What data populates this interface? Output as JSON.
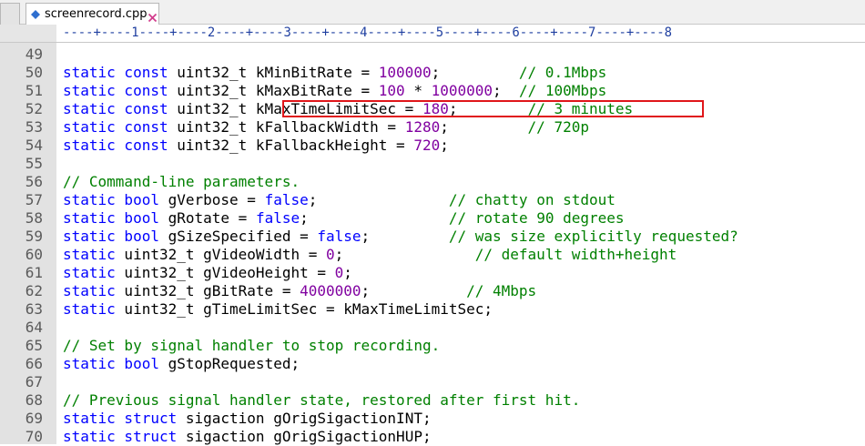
{
  "editor": {
    "tab": {
      "label": "screenrecord.cpp"
    },
    "ruler": "----+----1----+----2----+----3----+----4----+----5----+----6----+----7----+----8"
  },
  "colors": {
    "keyword": "#0000ff",
    "number": "#8000a0",
    "comment": "#008000",
    "highlight_border": "#e0161a"
  },
  "lines": [
    {
      "num": "49",
      "tokens": []
    },
    {
      "num": "50",
      "tokens": [
        {
          "t": "static const",
          "k": "kw"
        },
        {
          "t": " uint32_t kMinBitRate = ",
          "k": "plain"
        },
        {
          "t": "100000",
          "k": "num"
        },
        {
          "t": ";         ",
          "k": "plain"
        },
        {
          "t": "// 0.1Mbps",
          "k": "cm"
        }
      ]
    },
    {
      "num": "51",
      "tokens": [
        {
          "t": "static const",
          "k": "kw"
        },
        {
          "t": " uint32_t kMaxBitRate = ",
          "k": "plain"
        },
        {
          "t": "100",
          "k": "num"
        },
        {
          "t": " * ",
          "k": "plain"
        },
        {
          "t": "1000000",
          "k": "num"
        },
        {
          "t": ";  ",
          "k": "plain"
        },
        {
          "t": "// 100Mbps",
          "k": "cm"
        }
      ]
    },
    {
      "num": "52",
      "tokens": [
        {
          "t": "static const",
          "k": "kw"
        },
        {
          "t": " uint32_t kMaxTimeLimitSec = ",
          "k": "plain"
        },
        {
          "t": "180",
          "k": "num"
        },
        {
          "t": ";        ",
          "k": "plain"
        },
        {
          "t": "// 3 minutes",
          "k": "cm"
        }
      ]
    },
    {
      "num": "53",
      "tokens": [
        {
          "t": "static const",
          "k": "kw"
        },
        {
          "t": " uint32_t kFallbackWidth = ",
          "k": "plain"
        },
        {
          "t": "1280",
          "k": "num"
        },
        {
          "t": ";         ",
          "k": "plain"
        },
        {
          "t": "// 720p",
          "k": "cm"
        }
      ]
    },
    {
      "num": "54",
      "tokens": [
        {
          "t": "static const",
          "k": "kw"
        },
        {
          "t": " uint32_t kFallbackHeight = ",
          "k": "plain"
        },
        {
          "t": "720",
          "k": "num"
        },
        {
          "t": ";",
          "k": "plain"
        }
      ]
    },
    {
      "num": "55",
      "tokens": []
    },
    {
      "num": "56",
      "tokens": [
        {
          "t": "// Command-line parameters.",
          "k": "cm"
        }
      ]
    },
    {
      "num": "57",
      "tokens": [
        {
          "t": "static bool",
          "k": "kw"
        },
        {
          "t": " gVerbose = ",
          "k": "plain"
        },
        {
          "t": "false",
          "k": "kw"
        },
        {
          "t": ";               ",
          "k": "plain"
        },
        {
          "t": "// chatty on stdout",
          "k": "cm"
        }
      ]
    },
    {
      "num": "58",
      "tokens": [
        {
          "t": "static bool",
          "k": "kw"
        },
        {
          "t": " gRotate = ",
          "k": "plain"
        },
        {
          "t": "false",
          "k": "kw"
        },
        {
          "t": ";                ",
          "k": "plain"
        },
        {
          "t": "// rotate 90 degrees",
          "k": "cm"
        }
      ]
    },
    {
      "num": "59",
      "tokens": [
        {
          "t": "static bool",
          "k": "kw"
        },
        {
          "t": " gSizeSpecified = ",
          "k": "plain"
        },
        {
          "t": "false",
          "k": "kw"
        },
        {
          "t": ";         ",
          "k": "plain"
        },
        {
          "t": "// was size explicitly requested?",
          "k": "cm"
        }
      ]
    },
    {
      "num": "60",
      "tokens": [
        {
          "t": "static",
          "k": "kw"
        },
        {
          "t": " uint32_t gVideoWidth = ",
          "k": "plain"
        },
        {
          "t": "0",
          "k": "num"
        },
        {
          "t": ";               ",
          "k": "plain"
        },
        {
          "t": "// default width+height",
          "k": "cm"
        }
      ]
    },
    {
      "num": "61",
      "tokens": [
        {
          "t": "static",
          "k": "kw"
        },
        {
          "t": " uint32_t gVideoHeight = ",
          "k": "plain"
        },
        {
          "t": "0",
          "k": "num"
        },
        {
          "t": ";",
          "k": "plain"
        }
      ]
    },
    {
      "num": "62",
      "tokens": [
        {
          "t": "static",
          "k": "kw"
        },
        {
          "t": " uint32_t gBitRate = ",
          "k": "plain"
        },
        {
          "t": "4000000",
          "k": "num"
        },
        {
          "t": ";           ",
          "k": "plain"
        },
        {
          "t": "// 4Mbps",
          "k": "cm"
        }
      ]
    },
    {
      "num": "63",
      "tokens": [
        {
          "t": "static",
          "k": "kw"
        },
        {
          "t": " uint32_t gTimeLimitSec = kMaxTimeLimitSec;",
          "k": "plain"
        }
      ]
    },
    {
      "num": "64",
      "tokens": []
    },
    {
      "num": "65",
      "tokens": [
        {
          "t": "// Set by signal handler to stop recording.",
          "k": "cm"
        }
      ]
    },
    {
      "num": "66",
      "tokens": [
        {
          "t": "static bool",
          "k": "kw"
        },
        {
          "t": " gStopRequested;",
          "k": "plain"
        }
      ]
    },
    {
      "num": "67",
      "tokens": []
    },
    {
      "num": "68",
      "tokens": [
        {
          "t": "// Previous signal handler state, restored after first hit.",
          "k": "cm"
        }
      ]
    },
    {
      "num": "69",
      "tokens": [
        {
          "t": "static struct",
          "k": "kw"
        },
        {
          "t": " sigaction gOrigSigactionINT;",
          "k": "plain"
        }
      ]
    },
    {
      "num": "70",
      "tokens": [
        {
          "t": "static struct",
          "k": "kw"
        },
        {
          "t": " sigaction gOrigSigactionHUP;",
          "k": "plain"
        }
      ]
    }
  ]
}
